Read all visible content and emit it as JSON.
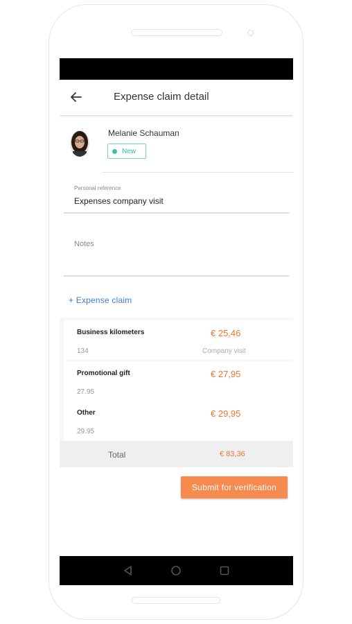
{
  "app_bar": {
    "title": "Expense claim detail"
  },
  "user": {
    "name": "Melanie Schauman",
    "status": "New"
  },
  "personal_reference": {
    "label": "Personal reference",
    "value": "Expenses company visit"
  },
  "notes": {
    "placeholder": "Notes"
  },
  "add_claim_label": "+ Expense claim",
  "claims": [
    {
      "title": "Business kilometers",
      "sub": "134",
      "amount": "€ 25,46",
      "note": "Company visit"
    },
    {
      "title": "Promotional gift",
      "sub": "27.95",
      "amount": "€ 27,95",
      "note": ""
    },
    {
      "title": "Other",
      "sub": "29.95",
      "amount": "€ 29,95",
      "note": ""
    }
  ],
  "total": {
    "label": "Total",
    "value": "€ 83,36"
  },
  "submit_label": "Submit for verification",
  "colors": {
    "accent": "#f78a4f",
    "link": "#3a7bd5",
    "status": "#35b9a1"
  },
  "icons": [
    "back-arrow-icon",
    "nav-back-icon",
    "nav-home-icon",
    "nav-recents-icon"
  ]
}
